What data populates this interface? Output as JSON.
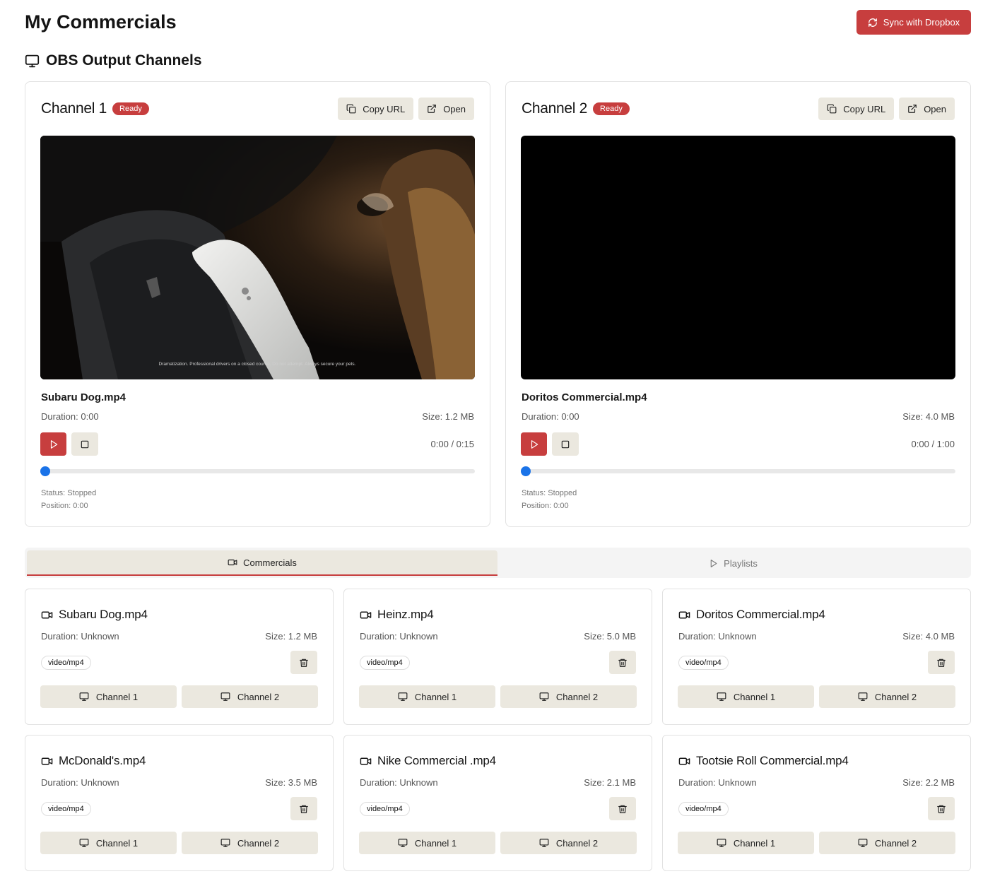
{
  "header": {
    "title": "My Commercials",
    "sync_label": "Sync with Dropbox"
  },
  "section": {
    "title": "OBS Output Channels"
  },
  "channels": [
    {
      "name": "Channel 1",
      "badge": "Ready",
      "copy_label": "Copy URL",
      "open_label": "Open",
      "video_caption": "Dramatization. Professional drivers on a closed course. Do not attempt. Always secure your pets.",
      "file": "Subaru Dog.mp4",
      "duration": "Duration: 0:00",
      "size": "Size: 1.2 MB",
      "time": "0:00 / 0:15",
      "progress": 0,
      "status": "Status: Stopped",
      "position": "Position: 0:00"
    },
    {
      "name": "Channel 2",
      "badge": "Ready",
      "copy_label": "Copy URL",
      "open_label": "Open",
      "video_caption": "",
      "file": "Doritos Commercial.mp4",
      "duration": "Duration: 0:00",
      "size": "Size: 4.0 MB",
      "time": "0:00 / 1:00",
      "progress": 0,
      "status": "Status: Stopped",
      "position": "Position: 0:00"
    }
  ],
  "tabs": [
    {
      "label": "Commercials",
      "active": true
    },
    {
      "label": "Playlists",
      "active": false
    }
  ],
  "commercials": [
    {
      "title": "Subaru Dog.mp4",
      "duration": "Duration: Unknown",
      "size": "Size: 1.2 MB",
      "mime": "video/mp4",
      "ch1": "Channel 1",
      "ch2": "Channel 2"
    },
    {
      "title": "Heinz.mp4",
      "duration": "Duration: Unknown",
      "size": "Size: 5.0 MB",
      "mime": "video/mp4",
      "ch1": "Channel 1",
      "ch2": "Channel 2"
    },
    {
      "title": "Doritos Commercial.mp4",
      "duration": "Duration: Unknown",
      "size": "Size: 4.0 MB",
      "mime": "video/mp4",
      "ch1": "Channel 1",
      "ch2": "Channel 2"
    },
    {
      "title": "McDonald's.mp4",
      "duration": "Duration: Unknown",
      "size": "Size: 3.5 MB",
      "mime": "video/mp4",
      "ch1": "Channel 1",
      "ch2": "Channel 2"
    },
    {
      "title": "Nike Commercial .mp4",
      "duration": "Duration: Unknown",
      "size": "Size: 2.1 MB",
      "mime": "video/mp4",
      "ch1": "Channel 1",
      "ch2": "Channel 2"
    },
    {
      "title": "Tootsie Roll Commercial.mp4",
      "duration": "Duration: Unknown",
      "size": "Size: 2.2 MB",
      "mime": "video/mp4",
      "ch1": "Channel 1",
      "ch2": "Channel 2"
    }
  ],
  "colors": {
    "accent": "#c73e3e",
    "button_bg": "#ebe8df",
    "slider": "#1a73e8"
  }
}
